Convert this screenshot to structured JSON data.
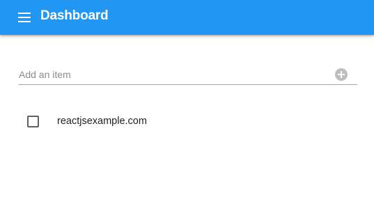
{
  "app_bar": {
    "title": "Dashboard",
    "menu_icon": "menu-icon",
    "color": "#2196f3"
  },
  "add_item": {
    "placeholder": "Add an item",
    "value": "",
    "add_icon": "add-circle-icon"
  },
  "items": [
    {
      "label": "reactjsexample.com",
      "checked": false
    }
  ]
}
